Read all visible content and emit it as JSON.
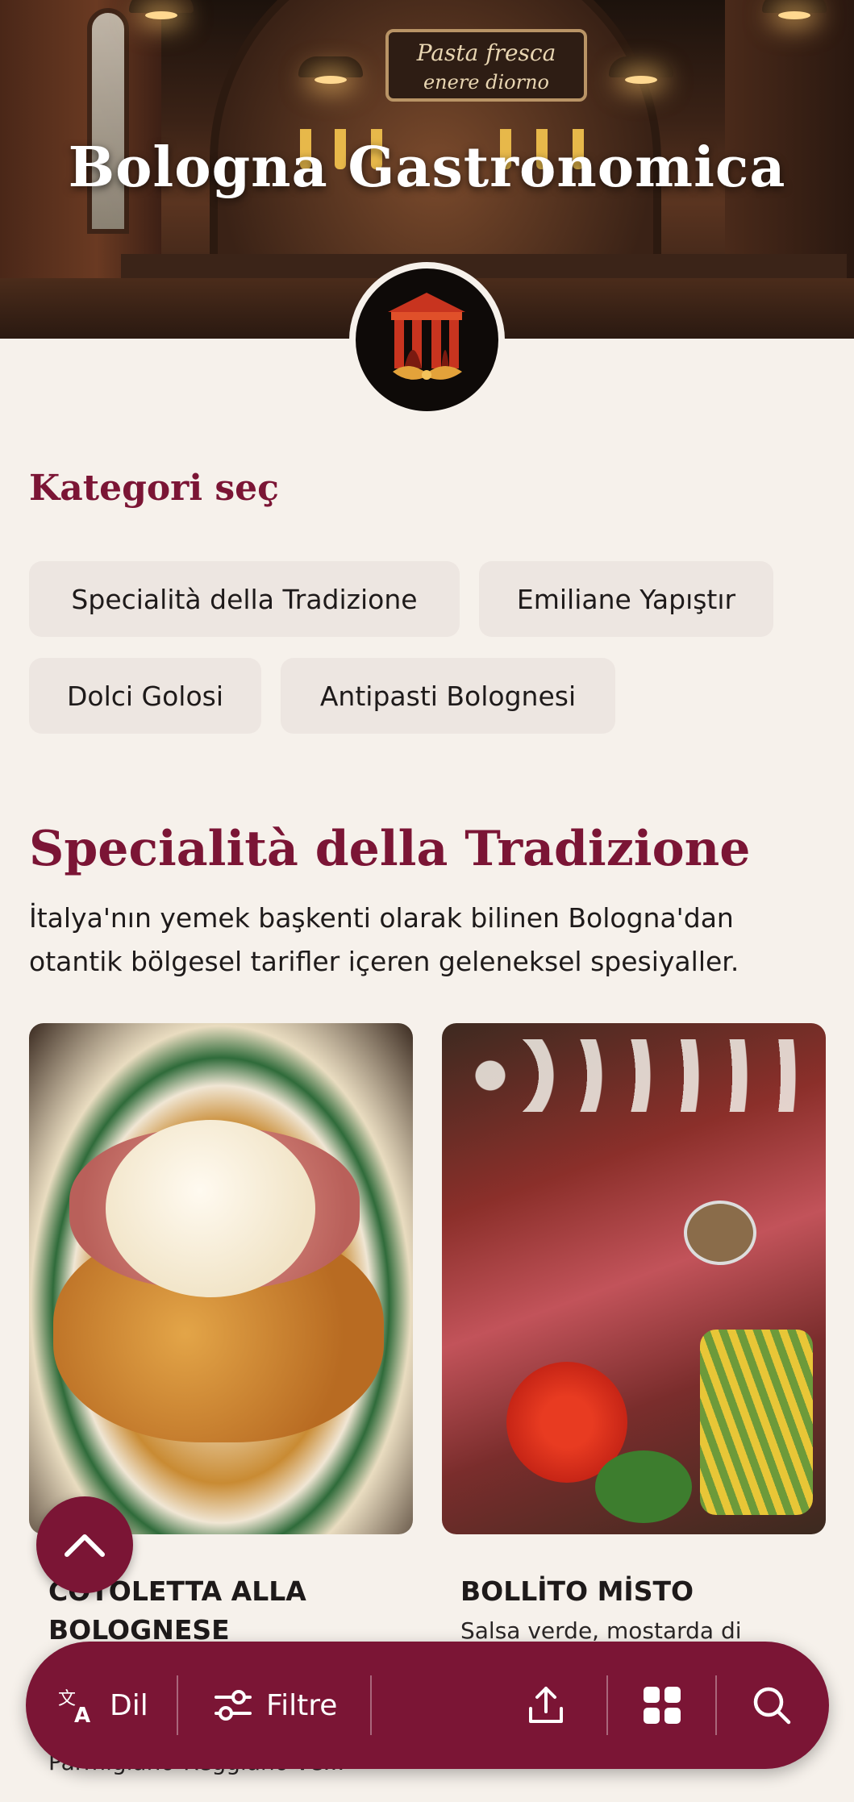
{
  "hero": {
    "title": "Bologna Gastronomica",
    "sign_line1": "Pasta fresca",
    "sign_line2": "enere diorno"
  },
  "categories": {
    "heading": "Kategori seç",
    "items": [
      {
        "label": "Specialità della Tradizione"
      },
      {
        "label": "Emiliane Yapıştır"
      },
      {
        "label": "Dolci Golosi"
      },
      {
        "label": "Antipasti Bolognesi"
      }
    ]
  },
  "section": {
    "title": "Specialità della Tradizione",
    "description": "İtalya'nın yemek başkenti olarak bilinen Bologna'dan otantik bölgesel tarifler içeren geleneksel spesiyaller."
  },
  "cards": [
    {
      "title_line1": "COTOLETTA ALLA",
      "title_line2": "BOLOGNESE",
      "subtitle": "Parmigiano-Reggiano ve..."
    },
    {
      "title": "BOLLİTO MİSTO",
      "subtitle": "Salsa verde, mostarda di"
    }
  ],
  "bottom_bar": {
    "language_label": "Dil",
    "filter_label": "Filtre"
  },
  "colors": {
    "accent": "#7b1535",
    "background": "#f6f1eb",
    "chip": "#ede6e1"
  },
  "icons": [
    "translate-icon",
    "filter-icon",
    "share-icon",
    "grid-icon",
    "search-icon",
    "chevron-up-icon"
  ]
}
